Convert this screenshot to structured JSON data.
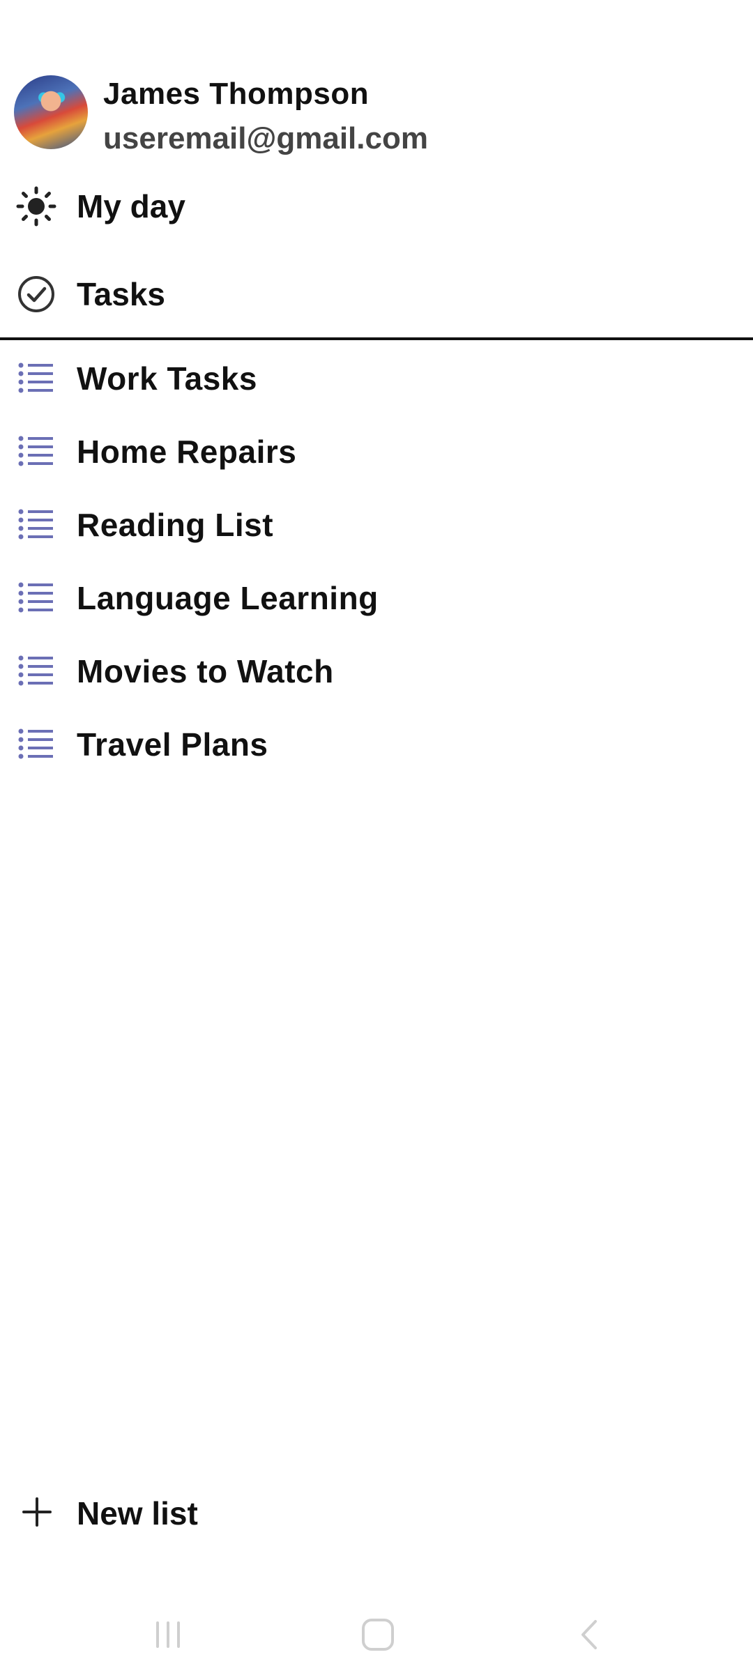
{
  "profile": {
    "name": "James Thompson",
    "email": "useremail@gmail.com"
  },
  "nav": {
    "my_day": {
      "label": "My day",
      "icon": "sun-icon"
    },
    "tasks": {
      "label": "Tasks",
      "icon": "check-circle-icon"
    }
  },
  "lists": [
    {
      "label": "Work Tasks",
      "icon": "list-icon"
    },
    {
      "label": "Home Repairs",
      "icon": "list-icon"
    },
    {
      "label": "Reading List",
      "icon": "list-icon"
    },
    {
      "label": "Language Learning",
      "icon": "list-icon"
    },
    {
      "label": "Movies to Watch",
      "icon": "list-icon"
    },
    {
      "label": "Travel Plans",
      "icon": "list-icon"
    }
  ],
  "new_list": {
    "label": "New list",
    "icon": "plus-icon"
  },
  "colors": {
    "list_icon": "#6b6fb5",
    "text": "#111111",
    "email": "#444444",
    "system_nav": "#cfcfcf"
  }
}
